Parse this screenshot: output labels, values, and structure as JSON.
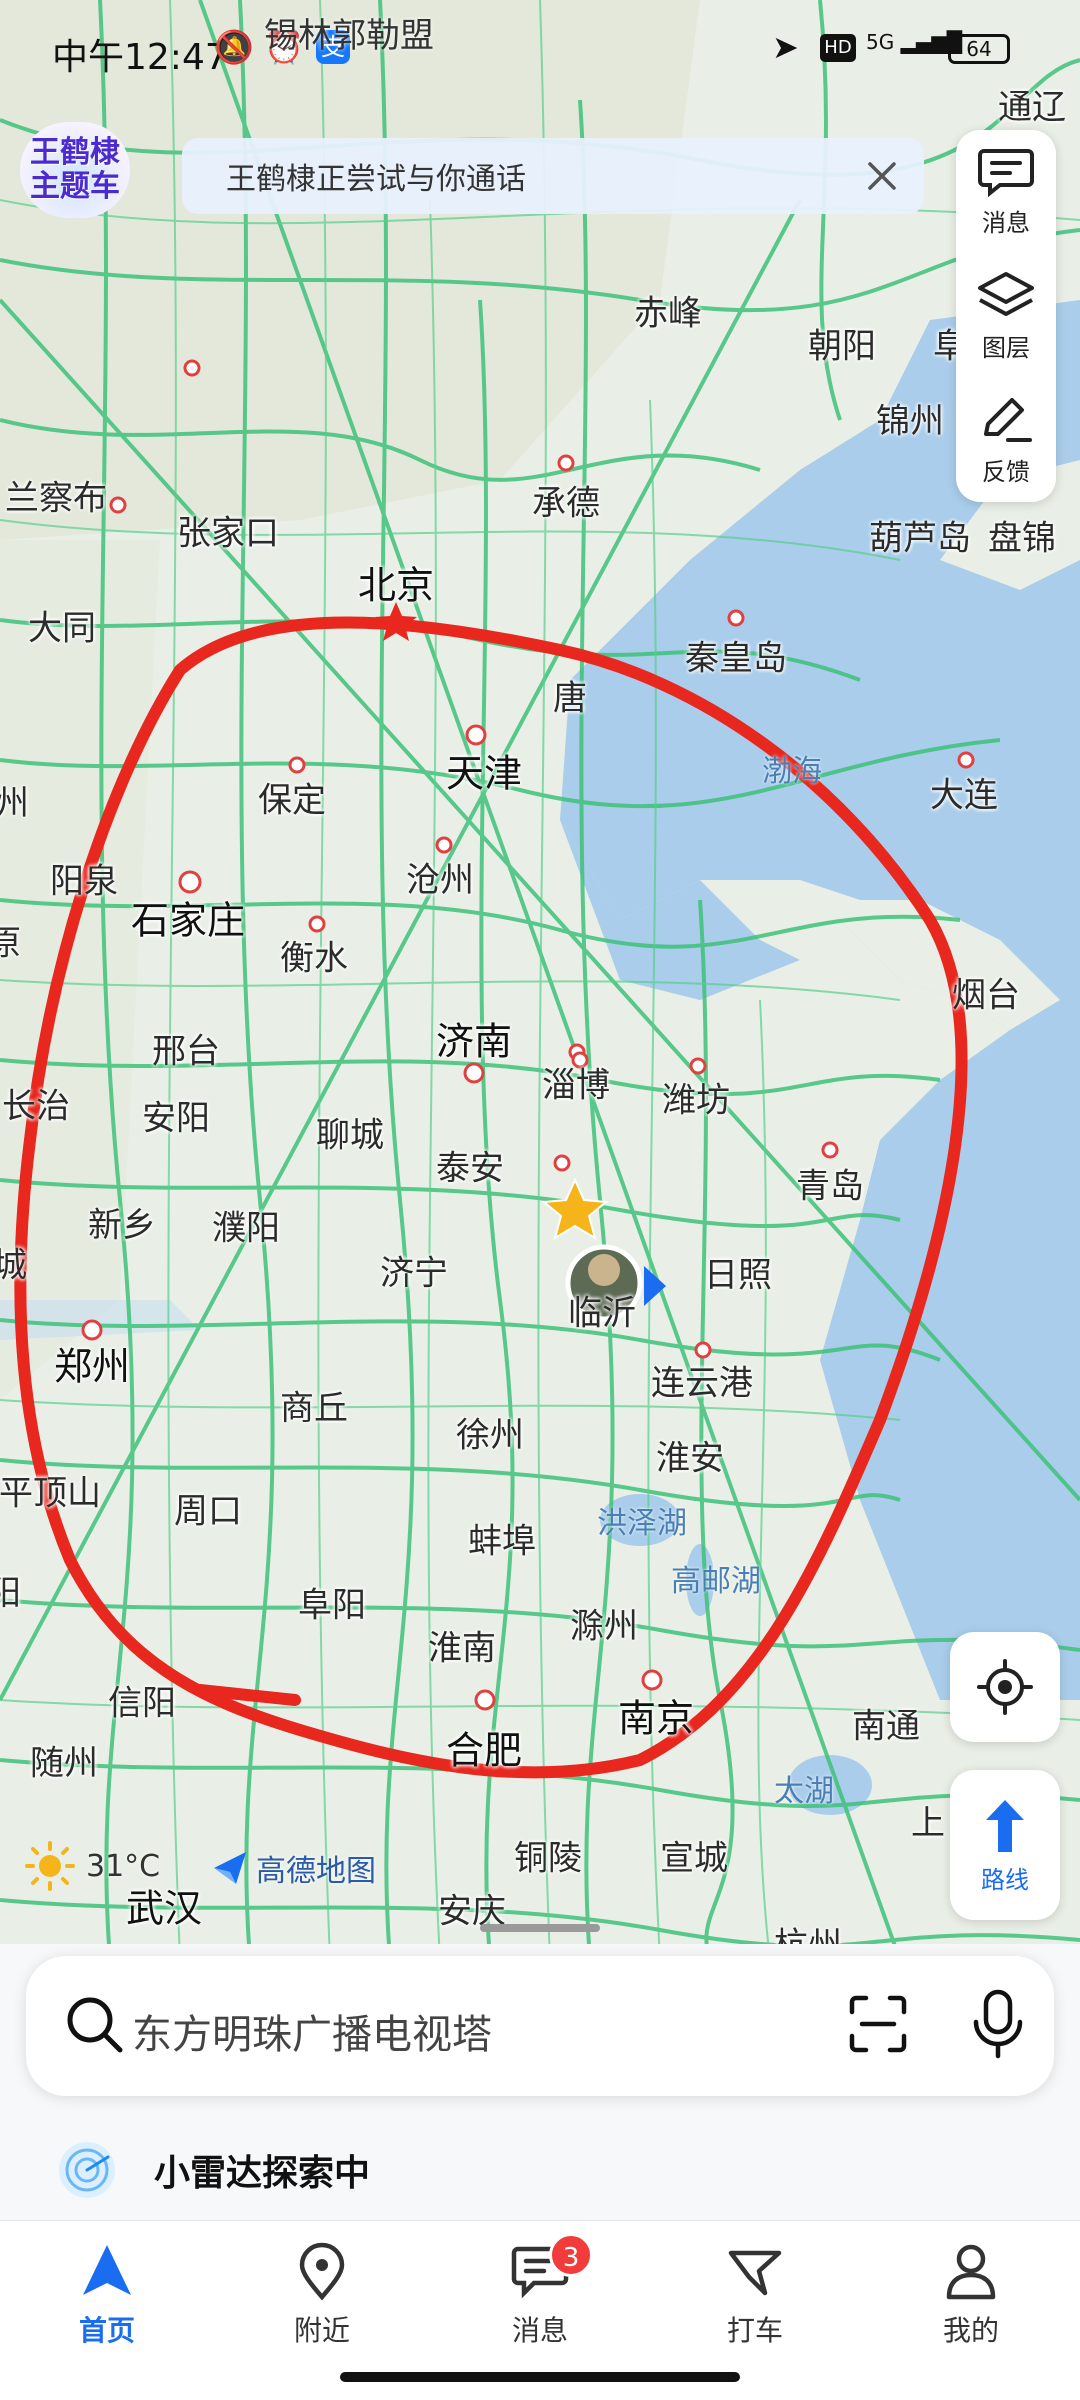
{
  "status_bar": {
    "time": "中午12:47",
    "region_label": "锡林郭勒盟",
    "hd": "HD",
    "network": "5G",
    "battery": "64"
  },
  "theme_badge": {
    "line1": "王鹤棣",
    "line2": "主题车"
  },
  "call_banner": {
    "text": "王鹤棣正尝试与你通话"
  },
  "tool_panel": {
    "messages_label": "消息",
    "layers_label": "图层",
    "feedback_label": "反馈"
  },
  "map": {
    "cities": [
      {
        "name": "通辽"
      },
      {
        "name": "赤峰"
      },
      {
        "name": "朝阳"
      },
      {
        "name": "阜"
      },
      {
        "name": "锦州"
      },
      {
        "name": "兰察布"
      },
      {
        "name": "张家口"
      },
      {
        "name": "承德"
      },
      {
        "name": "葫芦岛"
      },
      {
        "name": "盘锦"
      },
      {
        "name": "北京"
      },
      {
        "name": "大同"
      },
      {
        "name": "秦皇岛"
      },
      {
        "name": "唐"
      },
      {
        "name": "天津"
      },
      {
        "name": "大连"
      },
      {
        "name": "州"
      },
      {
        "name": "保定"
      },
      {
        "name": "阳泉"
      },
      {
        "name": "石家庄"
      },
      {
        "name": "沧州"
      },
      {
        "name": "衡水"
      },
      {
        "name": "原"
      },
      {
        "name": "烟台"
      },
      {
        "name": "邢台"
      },
      {
        "name": "济南"
      },
      {
        "name": "淄博"
      },
      {
        "name": "潍坊"
      },
      {
        "name": "长治"
      },
      {
        "name": "安阳"
      },
      {
        "name": "聊城"
      },
      {
        "name": "泰安"
      },
      {
        "name": "青岛"
      },
      {
        "name": "新乡"
      },
      {
        "name": "濮阳"
      },
      {
        "name": "济宁"
      },
      {
        "name": "临沂"
      },
      {
        "name": "日照"
      },
      {
        "name": "城"
      },
      {
        "name": "郑州"
      },
      {
        "name": "连云港"
      },
      {
        "name": "商丘"
      },
      {
        "name": "徐州"
      },
      {
        "name": "淮安"
      },
      {
        "name": "平顶山"
      },
      {
        "name": "周口"
      },
      {
        "name": "蚌埠"
      },
      {
        "name": "阜阳"
      },
      {
        "name": "滁州"
      },
      {
        "name": "阳"
      },
      {
        "name": "淮南"
      },
      {
        "name": "信阳"
      },
      {
        "name": "南京"
      },
      {
        "name": "南通"
      },
      {
        "name": "合肥"
      },
      {
        "name": "随州"
      },
      {
        "name": "铜陵"
      },
      {
        "name": "宣城"
      },
      {
        "name": "上"
      },
      {
        "name": "武汉"
      },
      {
        "name": "安庆"
      },
      {
        "name": "杭州"
      }
    ],
    "water": [
      {
        "name": "渤海"
      },
      {
        "name": "洪泽湖"
      },
      {
        "name": "高邮湖"
      },
      {
        "name": "太湖"
      }
    ]
  },
  "locate_button": {
    "icon": "crosshair-icon"
  },
  "route_button": {
    "label": "路线"
  },
  "weather": {
    "temp": "31°C"
  },
  "logo": {
    "text": "高德地图"
  },
  "search": {
    "placeholder": "东方明珠广播电视塔"
  },
  "radar": {
    "label": "小雷达探索中"
  },
  "tabs": [
    {
      "label": "首页",
      "active": true
    },
    {
      "label": "附近"
    },
    {
      "label": "消息",
      "badge": "3"
    },
    {
      "label": "打车"
    },
    {
      "label": "我的"
    }
  ],
  "colors": {
    "land": "#e9efe6",
    "sea": "#a9cdea",
    "road": "#3ec27a",
    "annotation": "#e8271e",
    "accent": "#1a6cf0"
  }
}
